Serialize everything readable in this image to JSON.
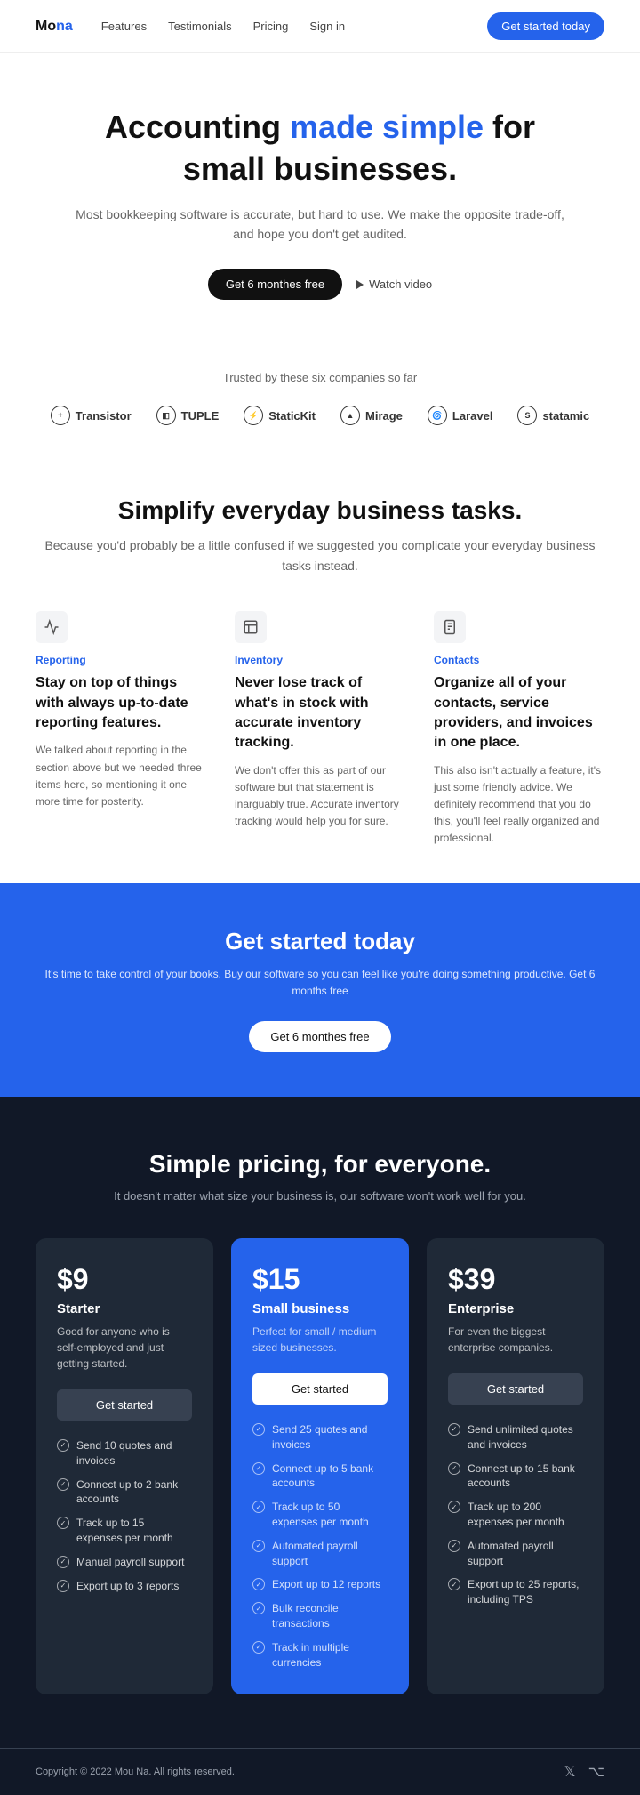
{
  "nav": {
    "logo_prefix": "Mo",
    "logo_accent": "na",
    "links": [
      "Features",
      "Testimonials",
      "Pricing",
      "Sign in"
    ],
    "cta": "Get started today"
  },
  "hero": {
    "title_plain": "Accounting ",
    "title_accent": "made simple",
    "title_suffix": " for small businesses.",
    "description": "Most bookkeeping software is accurate, but hard to use. We make the opposite trade-off, and hope you don't get audited.",
    "cta_primary": "Get 6 monthes free",
    "cta_secondary": "Watch video"
  },
  "trusted": {
    "label": "Trusted by these six companies so far",
    "logos": [
      {
        "name": "Transistor",
        "icon": "+"
      },
      {
        "name": "TUPLE",
        "icon": "T"
      },
      {
        "name": "StaticKit",
        "icon": "S"
      },
      {
        "name": "Mirage",
        "icon": "M"
      },
      {
        "name": "Laravel",
        "icon": "L"
      },
      {
        "name": "statamic",
        "icon": "S"
      }
    ]
  },
  "features": {
    "heading": "Simplify everyday business tasks.",
    "subheading": "Because you'd probably be a little confused if we suggested you complicate your everyday business tasks instead.",
    "items": [
      {
        "label": "Reporting",
        "title": "Stay on top of things with always up-to-date reporting features.",
        "desc": "We talked about reporting in the section above but we needed three items here, so mentioning it one more time for posterity."
      },
      {
        "label": "Inventory",
        "title": "Never lose track of what's in stock with accurate inventory tracking.",
        "desc": "We don't offer this as part of our software but that statement is inarguably true. Accurate inventory tracking would help you for sure."
      },
      {
        "label": "Contacts",
        "title": "Organize all of your contacts, service providers, and invoices in one place.",
        "desc": "This also isn't actually a feature, it's just some friendly advice. We definitely recommend that you do this, you'll feel really organized and professional."
      }
    ]
  },
  "cta_band": {
    "heading": "Get started today",
    "description": "It's time to take control of your books. Buy our software so you can feel like you're doing something productive. Get 6 months free",
    "cta": "Get 6 monthes free"
  },
  "pricing": {
    "heading": "Simple pricing, for everyone.",
    "subheading": "It doesn't matter what size your business is, our software won't work well for you.",
    "plans": [
      {
        "price": "$9",
        "name": "Starter",
        "desc": "Good for anyone who is self-employed and just getting started.",
        "cta": "Get started",
        "featured": false,
        "features": [
          "Send 10 quotes and invoices",
          "Connect up to 2 bank accounts",
          "Track up to 15 expenses per month",
          "Manual payroll support",
          "Export up to 3 reports"
        ]
      },
      {
        "price": "$15",
        "name": "Small business",
        "desc": "Perfect for small / medium sized businesses.",
        "cta": "Get started",
        "featured": true,
        "features": [
          "Send 25 quotes and invoices",
          "Connect up to 5 bank accounts",
          "Track up to 50 expenses per month",
          "Automated payroll support",
          "Export up to 12 reports",
          "Bulk reconcile transactions",
          "Track in multiple currencies"
        ]
      },
      {
        "price": "$39",
        "name": "Enterprise",
        "desc": "For even the biggest enterprise companies.",
        "cta": "Get started",
        "featured": false,
        "features": [
          "Send unlimited quotes and invoices",
          "Connect up to 15 bank accounts",
          "Track up to 200 expenses per month",
          "Automated payroll support",
          "Export up to 25 reports, including TPS"
        ]
      }
    ]
  },
  "footer": {
    "copy": "Copyright © 2022 Mou Na. All rights reserved."
  }
}
